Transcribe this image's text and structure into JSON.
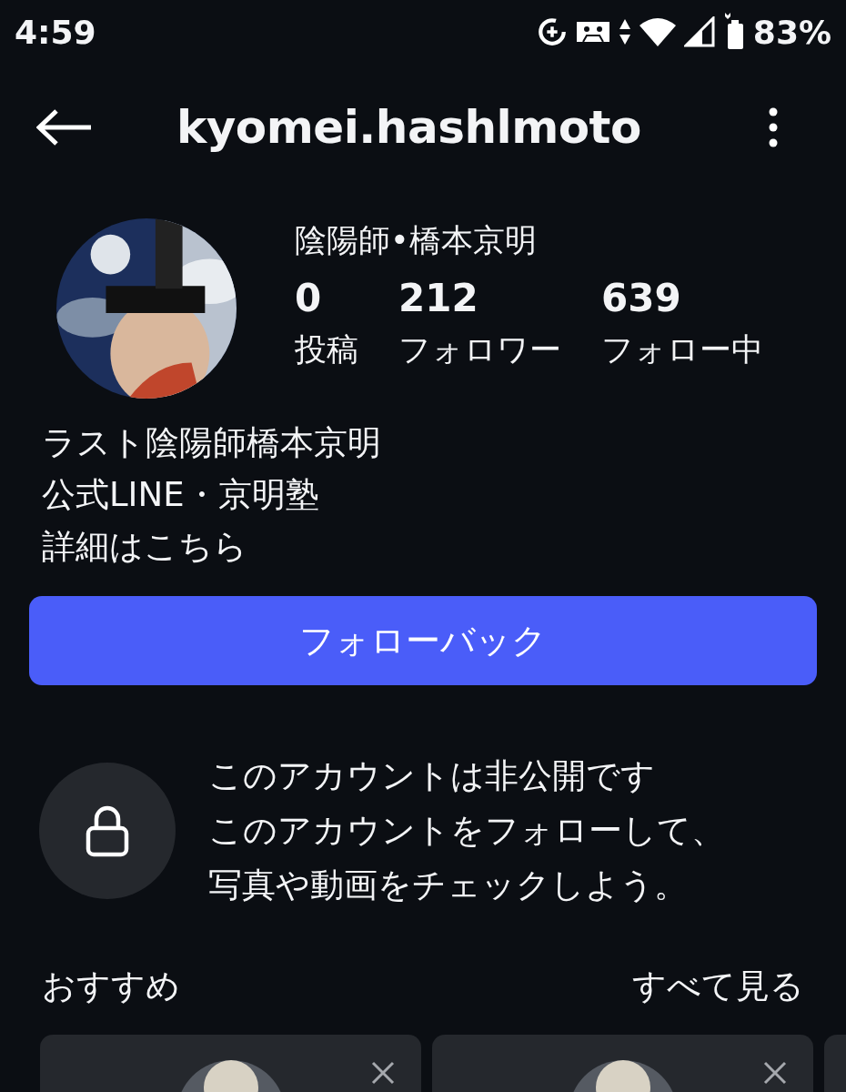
{
  "status_bar": {
    "time": "4:59",
    "battery": "83%"
  },
  "header": {
    "username": "kyomei.hashlmoto"
  },
  "profile": {
    "display_name": "陰陽師•橋本京明",
    "stats": [
      {
        "value": "0",
        "label": "投稿"
      },
      {
        "value": "212",
        "label": "フォロワー"
      },
      {
        "value": "639",
        "label": "フォロー中"
      }
    ],
    "bio": [
      "ラスト陰陽師橋本京明",
      "公式LINE・京明塾",
      "詳細はこちら"
    ]
  },
  "follow_button": {
    "label": "フォローバック"
  },
  "private_notice": {
    "title": "このアカウントは非公開です",
    "lines": [
      "このアカウントをフォローして、",
      "写真や動画をチェックしよう。"
    ]
  },
  "suggestions": {
    "title": "おすすめ",
    "see_all": "すべて見る"
  }
}
